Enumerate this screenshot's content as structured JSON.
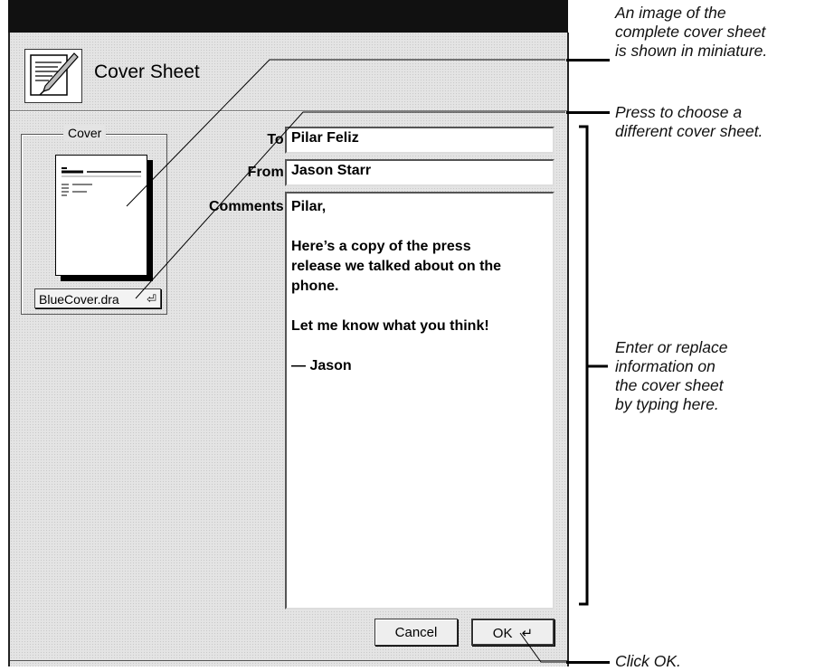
{
  "dialog": {
    "title": "Cover Sheet",
    "icon": "pen-and-paper-icon",
    "cover_group_label": "Cover",
    "cover_file": "BlueCover.dra",
    "cover_menu_icon": "popup-menu-icon"
  },
  "fields": {
    "to_label": "To:",
    "to_value": "Pilar Feliz",
    "from_label": "From:",
    "from_value": "Jason Starr",
    "comments_label": "Comments:",
    "comments_value": "Pilar,\n\nHere’s a copy of the press\nrelease we talked about on the\nphone.\n\nLet me know what you think!\n\n— Jason"
  },
  "buttons": {
    "cancel": "Cancel",
    "ok": "OK",
    "ok_icon": "return-key-icon"
  },
  "callouts": {
    "miniature": "An image of the\ncomplete cover sheet\nis shown in miniature.",
    "choose": "Press to choose a\ndifferent cover sheet.",
    "enter": "Enter or replace\ninformation on\nthe cover sheet\nby typing here.",
    "ok": "Click OK."
  }
}
